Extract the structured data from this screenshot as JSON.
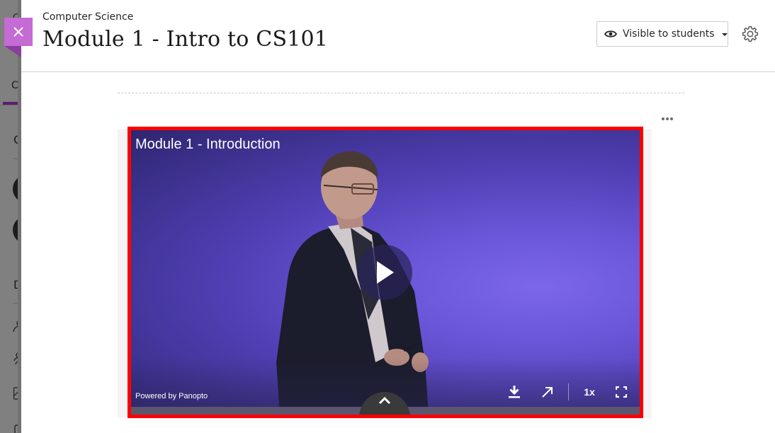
{
  "background_page": {
    "tab_partial": "Co",
    "top_partial": "C",
    "section_1_partial": "C",
    "section_2_partial": "D"
  },
  "panel": {
    "breadcrumb": "Computer Science",
    "title": "Module 1 - Intro to CS101",
    "visibility": {
      "label": "Visible to students",
      "icon": "eye-icon"
    },
    "settings_icon": "gear-icon",
    "close_icon": "close-icon",
    "more_options_icon": "more-horizontal-icon"
  },
  "video": {
    "title": "Module 1 - Introduction",
    "powered_by": "Powered by Panopto",
    "speed": "1x",
    "controls": [
      "download-icon",
      "open-external-icon",
      "speed",
      "fullscreen-icon"
    ],
    "play_icon": "play-icon",
    "expand_icon": "chevron-up-icon"
  },
  "colors": {
    "close_button": "#c56bd4",
    "highlight_border": "#ff0000",
    "video_bg": "#6a56d8",
    "accent_tab": "#5a1f6e"
  }
}
